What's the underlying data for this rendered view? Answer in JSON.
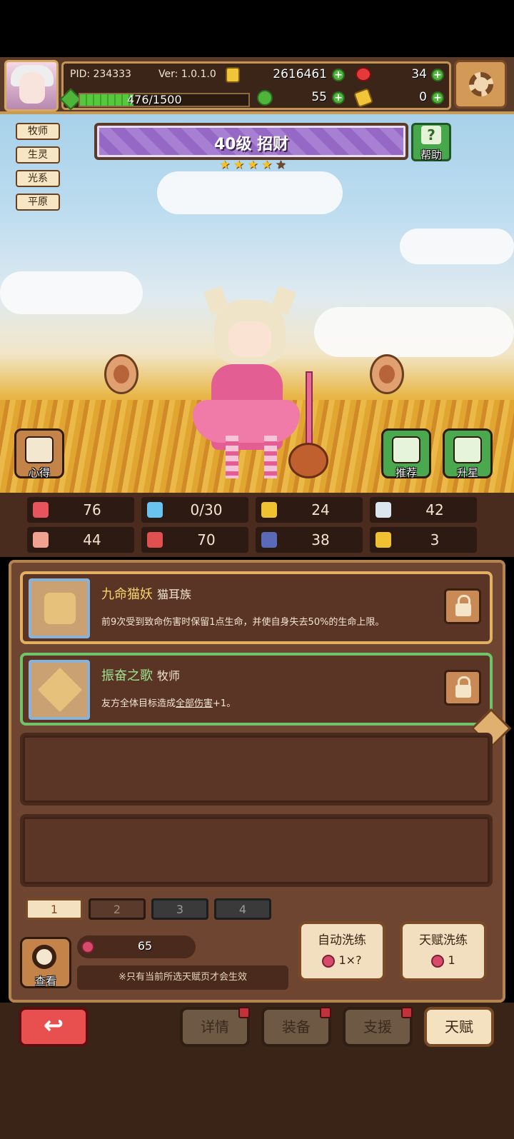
{
  "header": {
    "pid": "PID: 234333",
    "version": "Ver: 1.0.1.0",
    "gold": "2616461",
    "ruby": "34",
    "exp": "476/1500",
    "exp_fraction": 0.317,
    "clover": "55",
    "key": "0"
  },
  "tags": [
    "牧师",
    "生灵",
    "光系",
    "平原"
  ],
  "hero": {
    "title": "40级 招财",
    "stars_filled": 4,
    "stars_total": 5
  },
  "buttons": {
    "help": "帮助",
    "tips": "心得",
    "recommend": "推荐",
    "star_up": "升星",
    "look": "查看"
  },
  "stats": [
    {
      "icon": "heart-icon",
      "value": "76",
      "color": "#e8545e"
    },
    {
      "icon": "mana-drop-icon",
      "value": "0/30",
      "color": "#6ac3ee"
    },
    {
      "icon": "shield-icon",
      "value": "24",
      "color": "#f0c232"
    },
    {
      "icon": "wing-icon",
      "value": "42",
      "color": "#dce6f0"
    },
    {
      "icon": "fist-icon",
      "value": "44",
      "color": "#f2a290"
    },
    {
      "icon": "book-icon",
      "value": "70",
      "color": "#e05050"
    },
    {
      "icon": "boot-icon",
      "value": "38",
      "color": "#5a6ab8"
    },
    {
      "icon": "horseshoe-icon",
      "value": "3",
      "color": "#f0c232"
    }
  ],
  "talents": [
    {
      "name": "九命猫妖",
      "type": "猫耳族",
      "desc": "前9次受到致命伤害时保留1点生命，并使自身失去50%的生命上限。"
    },
    {
      "name": "振奋之歌",
      "type": "牧师",
      "desc_prefix": "友方全体目标造成",
      "desc_underline": "全部伤害",
      "desc_suffix": "+1。"
    }
  ],
  "pages": [
    "1",
    "2",
    "3",
    "4"
  ],
  "bottom": {
    "fruit_count": "65",
    "note": "※只有当前所选天赋页才会生效",
    "auto_wash_label": "自动洗练",
    "auto_wash_value": "1×?",
    "talent_wash_label": "天赋洗练",
    "talent_wash_value": "1"
  },
  "nav": {
    "details": "详情",
    "equip": "装备",
    "support": "支援",
    "talent": "天赋"
  }
}
